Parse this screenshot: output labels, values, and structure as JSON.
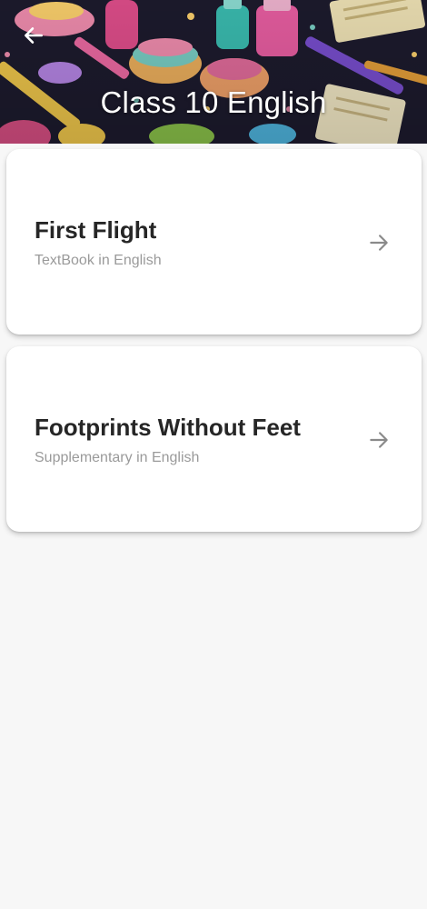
{
  "header": {
    "title": "Class 10 English",
    "back_icon": "arrow-left-icon"
  },
  "books": [
    {
      "title": "First Flight",
      "subtitle": "TextBook in English",
      "icon": "arrow-right-icon"
    },
    {
      "title": "Footprints Without Feet",
      "subtitle": "Supplementary in English",
      "icon": "arrow-right-icon"
    }
  ],
  "colors": {
    "page_background": "#f7f7f7",
    "card_background": "#ffffff",
    "title_text": "#262626",
    "subtitle_text": "#9a9a9a",
    "arrow": "#8a8a8a"
  }
}
